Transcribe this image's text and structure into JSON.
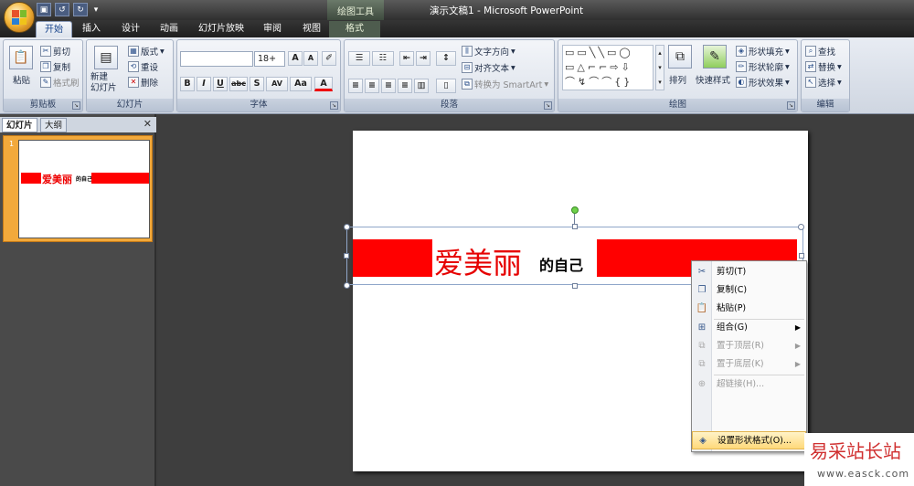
{
  "window": {
    "app_title": "演示文稿1 - Microsoft PowerPoint",
    "contextual_tools_label": "绘图工具"
  },
  "tabs": [
    {
      "label": "开始",
      "active": true
    },
    {
      "label": "插入"
    },
    {
      "label": "设计"
    },
    {
      "label": "动画"
    },
    {
      "label": "幻灯片放映"
    },
    {
      "label": "审阅"
    },
    {
      "label": "视图"
    },
    {
      "label": "格式"
    }
  ],
  "ribbon": {
    "clipboard": {
      "label": "剪贴板",
      "paste": "粘贴",
      "cut": "剪切",
      "copy": "复制",
      "format_painter": "格式刷"
    },
    "slides": {
      "label": "幻灯片",
      "new_slide": "新建\n幻灯片",
      "layout": "版式",
      "reset": "重设",
      "delete": "删除"
    },
    "font": {
      "label": "字体",
      "font_name": "",
      "font_size": "18+",
      "bold": "B",
      "italic": "I",
      "underline": "U",
      "strike": "abc",
      "shadow": "S",
      "spacing": "AV",
      "case": "Aa",
      "color": "A"
    },
    "paragraph": {
      "label": "段落",
      "text_direction": "文字方向",
      "align_text": "对齐文本",
      "smartart": "转换为 SmartArt"
    },
    "drawing": {
      "label": "绘图",
      "arrange": "排列",
      "quick_styles": "快速样式",
      "shape_fill": "形状填充",
      "shape_outline": "形状轮廓",
      "shape_effects": "形状效果"
    },
    "editing": {
      "label": "编辑",
      "find": "查找",
      "replace": "替换",
      "select": "选择"
    }
  },
  "left_pane": {
    "tab_slides": "幻灯片",
    "tab_outline": "大纲",
    "close": "✕",
    "thumb_number": "1",
    "thumb_text_big": "爱美丽",
    "thumb_text_small": "的自己"
  },
  "slide": {
    "text_big": "爱美丽",
    "text_small": "的自己",
    "accent_color": "#ff0000"
  },
  "context_menu": {
    "items": [
      {
        "label": "剪切(T)",
        "icon": "scissors-icon",
        "enabled": true
      },
      {
        "label": "复制(C)",
        "icon": "copy-icon",
        "enabled": true
      },
      {
        "label": "粘贴(P)",
        "icon": "paste-icon",
        "enabled": true
      },
      {
        "label": "组合(G)",
        "icon": "group-icon",
        "enabled": true,
        "submenu": true
      },
      {
        "label": "置于顶层(R)",
        "icon": "bring-front-icon",
        "enabled": false,
        "submenu": true
      },
      {
        "label": "置于底层(K)",
        "icon": "send-back-icon",
        "enabled": false,
        "submenu": true
      },
      {
        "label": "超链接(H)...",
        "icon": "hyperlink-icon",
        "enabled": false
      },
      {
        "label": "设置形状格式(O)...",
        "icon": "format-shape-icon",
        "enabled": true
      }
    ]
  },
  "watermark": {
    "text": "易采站长站",
    "url": "www.easck.com"
  }
}
